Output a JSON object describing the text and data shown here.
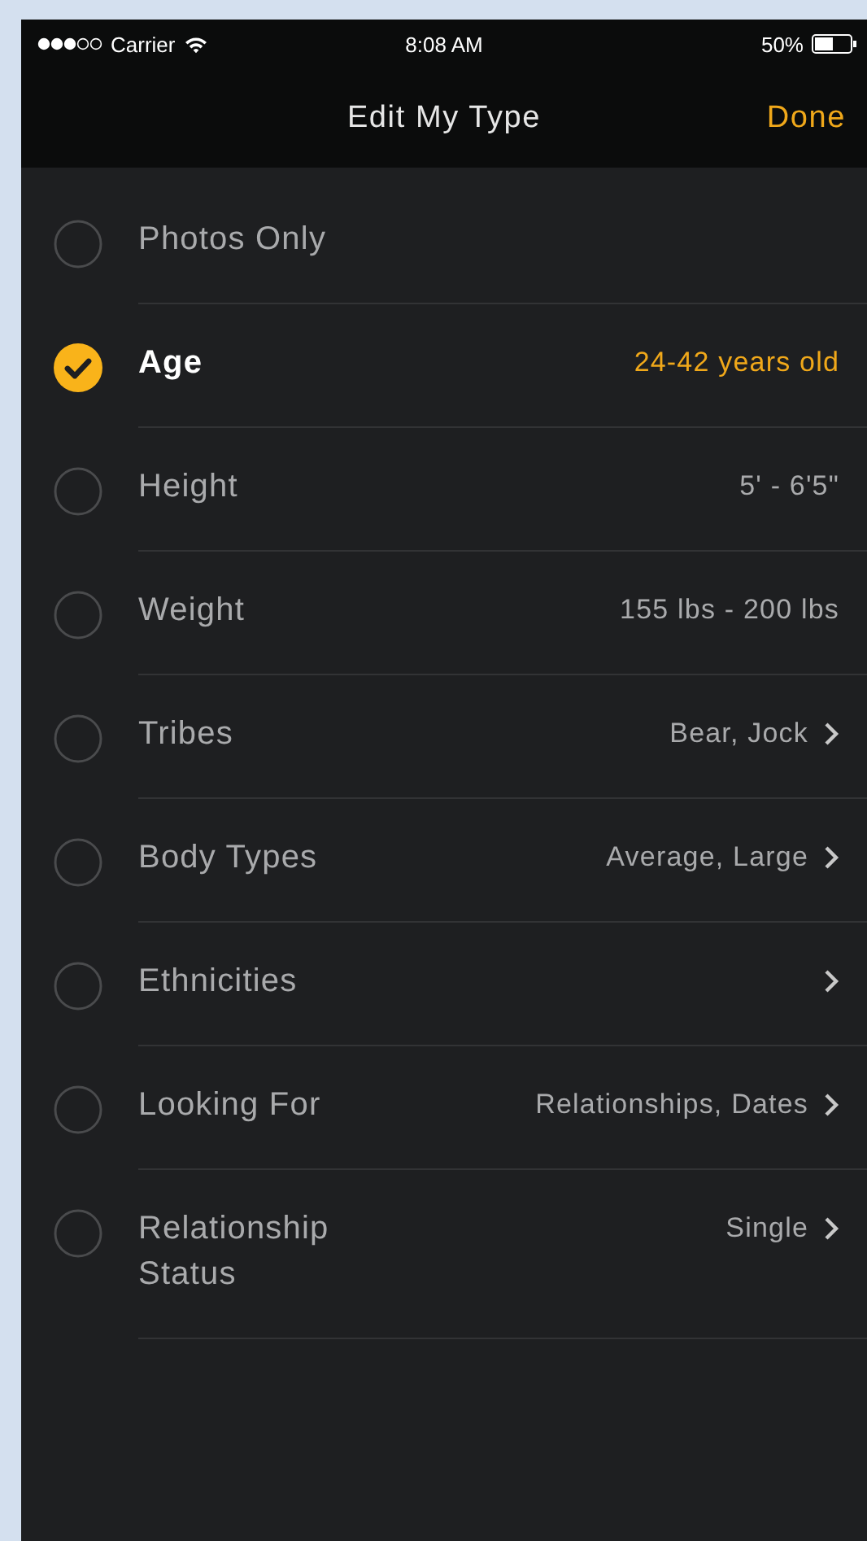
{
  "status_bar": {
    "carrier": "Carrier",
    "time": "8:08 AM",
    "battery": "50%"
  },
  "nav": {
    "title": "Edit My Type",
    "done": "Done"
  },
  "filters": [
    {
      "label": "Photos Only",
      "selected": false,
      "chevron": false
    },
    {
      "label": "Age",
      "value": "24-42 years old",
      "selected": true,
      "chevron": false
    },
    {
      "label": "Height",
      "value": "5' - 6'5\"",
      "selected": false,
      "chevron": false
    },
    {
      "label": "Weight",
      "value": "155 lbs - 200 lbs",
      "selected": false,
      "chevron": false
    },
    {
      "label": "Tribes",
      "value": "Bear, Jock",
      "selected": false,
      "chevron": true
    },
    {
      "label": "Body Types",
      "value": "Average, Large",
      "selected": false,
      "chevron": true
    },
    {
      "label": "Ethnicities",
      "selected": false,
      "chevron": true
    },
    {
      "label": "Looking For",
      "value": "Relationships, Dates",
      "selected": false,
      "chevron": true
    },
    {
      "label": "Relationship Status",
      "value": "Single",
      "selected": false,
      "chevron": true
    }
  ]
}
